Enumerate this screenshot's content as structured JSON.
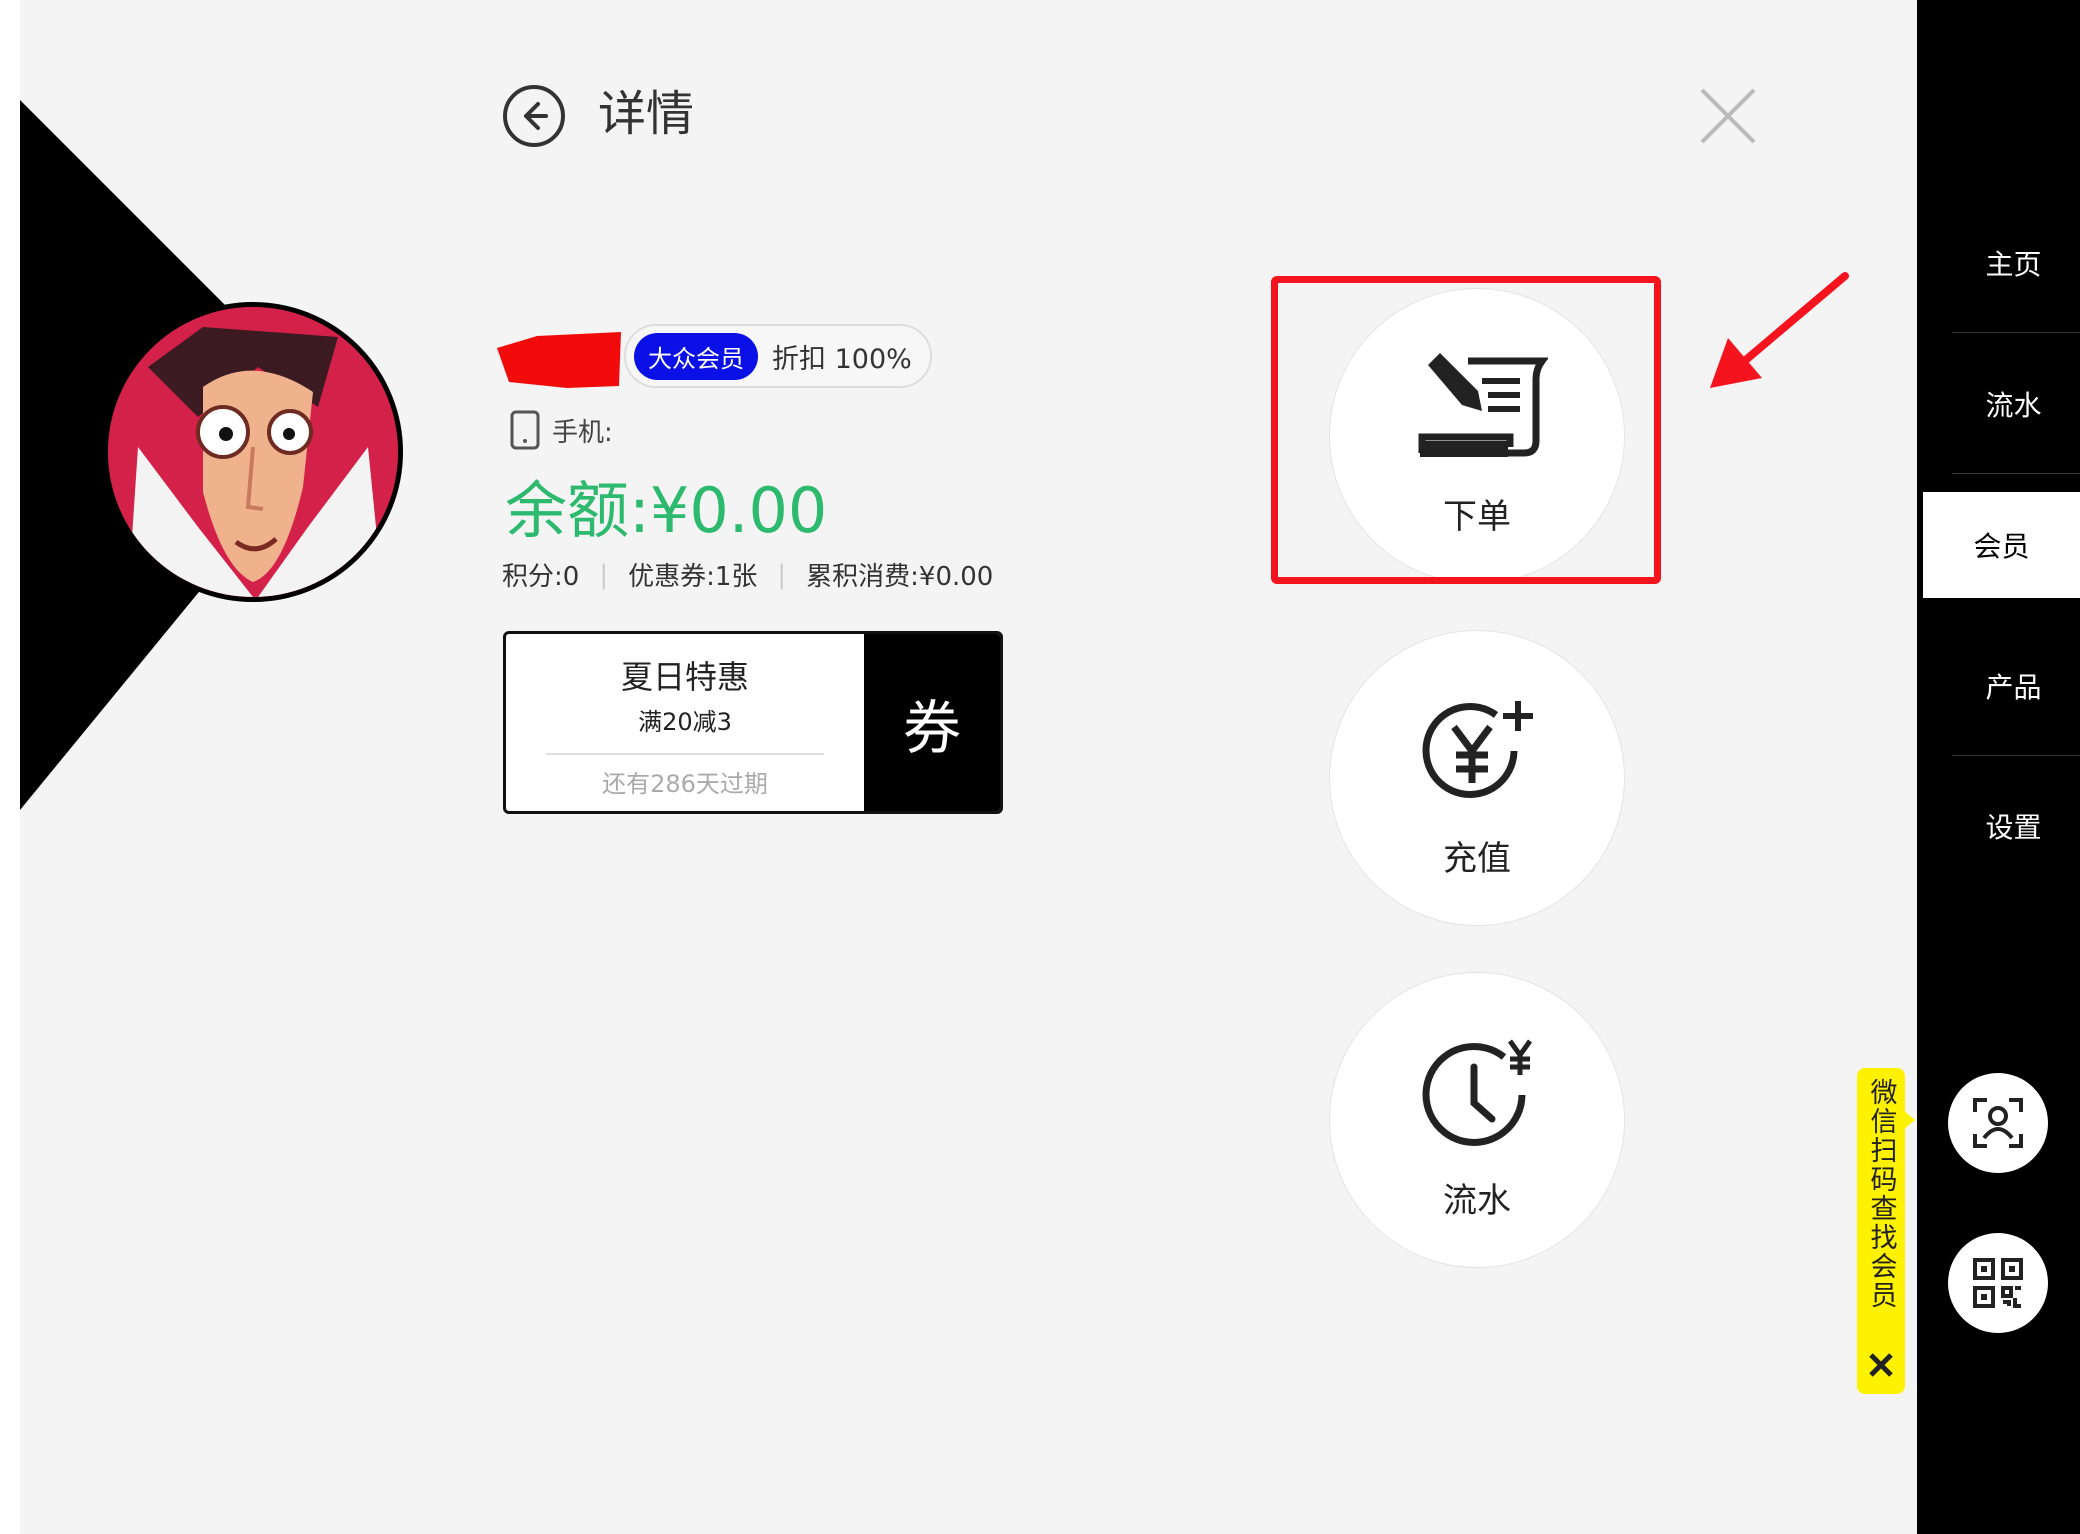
{
  "header": {
    "title": "详情"
  },
  "member": {
    "level_badge": "大众会员",
    "discount": "折扣 100%",
    "phone_label": "手机:",
    "balance": "余额:¥0.00",
    "stats": {
      "points": "积分:0",
      "coupons": "优惠券:1张",
      "total_spent": "累积消费:¥0.00"
    }
  },
  "coupon": {
    "title": "夏日特惠",
    "rule": "满20减3",
    "expiry": "还有286天过期",
    "tag": "券"
  },
  "actions": [
    {
      "label": "下单",
      "icon": "order-scroll-icon"
    },
    {
      "label": "充值",
      "icon": "recharge-yen-icon"
    },
    {
      "label": "流水",
      "icon": "history-clock-icon"
    }
  ],
  "sidebar": {
    "items": [
      {
        "label": "主页"
      },
      {
        "label": "流水"
      },
      {
        "label": "会员",
        "active": true
      },
      {
        "label": "产品"
      },
      {
        "label": "设置"
      }
    ]
  },
  "scan_tip": "微信扫码查找会员",
  "colors": {
    "balance": "#2dba6e",
    "badge": "#0a10e6",
    "highlight": "#f5141e",
    "tip": "#fff200"
  }
}
